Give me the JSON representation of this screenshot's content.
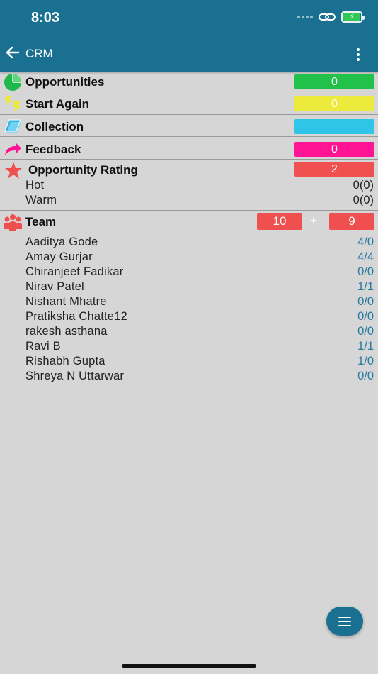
{
  "status_bar": {
    "time": "8:03"
  },
  "app_bar": {
    "title": "CRM"
  },
  "summary": [
    {
      "label": "Opportunities",
      "count": "0",
      "color": "#22c24a",
      "icon": "pie-chart-icon"
    },
    {
      "label": "Start Again",
      "count": "0",
      "color": "#ecea3a",
      "icon": "swap-arrows-icon"
    },
    {
      "label": "Collection",
      "count": "",
      "color": "#2fc5e8",
      "icon": "cards-icon"
    },
    {
      "label": "Feedback",
      "count": "0",
      "color": "#ff1493",
      "icon": "forward-arrow-icon"
    }
  ],
  "rating": {
    "label": "Opportunity Rating",
    "count": "2",
    "color": "#f05050",
    "icon": "star-icon",
    "items": [
      {
        "label": "Hot",
        "value": "0(0)"
      },
      {
        "label": "Warm",
        "value": "0(0)"
      }
    ]
  },
  "team": {
    "label": "Team",
    "count_left": "10",
    "plus": "+",
    "count_right": "9",
    "color": "#f04f4f",
    "icon": "team-icon",
    "members": [
      {
        "name": "Aaditya Gode",
        "value": "4/0"
      },
      {
        "name": "Amay Gurjar",
        "value": "4/4"
      },
      {
        "name": "Chiranjeet Fadikar",
        "value": "0/0"
      },
      {
        "name": "Nirav Patel",
        "value": "1/1"
      },
      {
        "name": "Nishant Mhatre",
        "value": "0/0"
      },
      {
        "name": "Pratiksha Chatte12",
        "value": "0/0"
      },
      {
        "name": "rakesh asthana",
        "value": "0/0"
      },
      {
        "name": "Ravi B",
        "value": "1/1"
      },
      {
        "name": "Rishabh Gupta",
        "value": "1/0"
      },
      {
        "name": "Shreya N Uttarwar",
        "value": "0/0"
      }
    ]
  }
}
